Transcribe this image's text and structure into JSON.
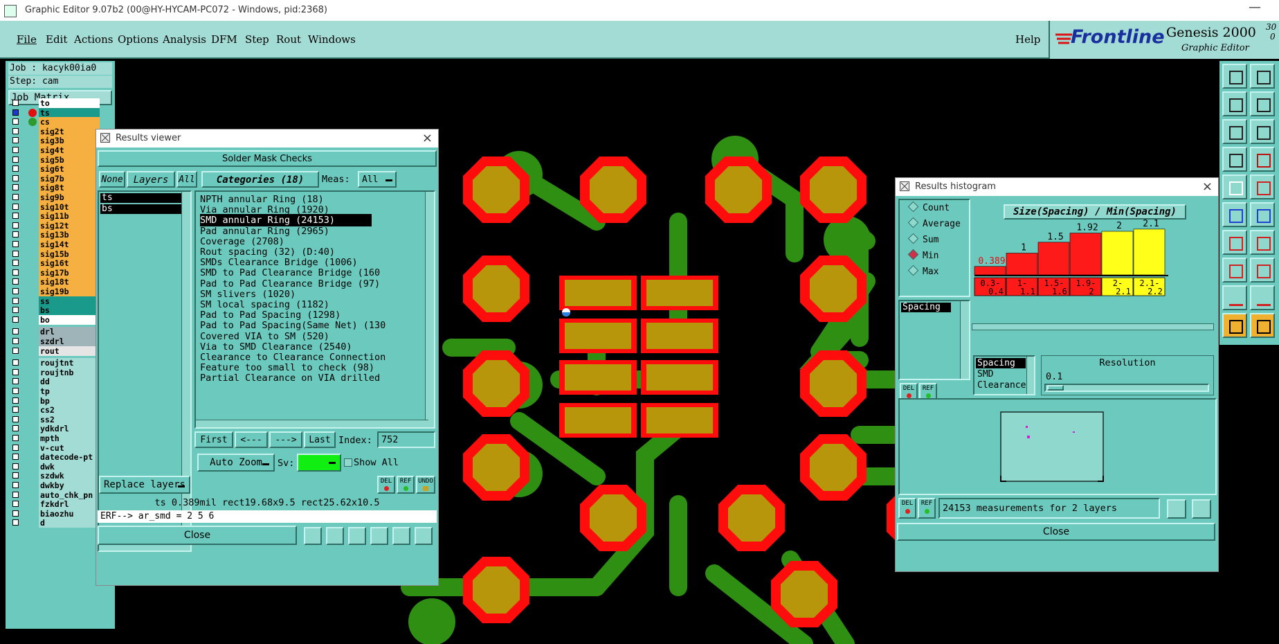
{
  "window": {
    "title": "Graphic Editor 9.07b2 (00@HY-HYCAM-PC072 - Windows, pid:2368)",
    "minimize_glyph": "—"
  },
  "menu": {
    "items": [
      "File",
      "Edit",
      "Actions",
      "Options",
      "Analysis",
      "DFM",
      "Step",
      "Rout",
      "Windows"
    ],
    "help": "Help"
  },
  "brand": {
    "logo": "Frontline",
    "product": "Genesis 2000",
    "version_top": "30",
    "version_bottom": "0",
    "subtitle": "Graphic Editor"
  },
  "job": {
    "job_label": "Job : kacyk00ia0",
    "step_label": "Step: cam",
    "matrix_button": "Job Matrix ..."
  },
  "layers": [
    {
      "name": "to",
      "bg": "#ffffff",
      "dot": ""
    },
    {
      "name": "ts",
      "bg": "#1a9a8a",
      "dot": "#e01010",
      "selected": true
    },
    {
      "name": "cs",
      "bg": "#f5b041",
      "dot": "#2c9a2c"
    },
    {
      "name": "sig2t",
      "bg": "#f5b041",
      "dot": ""
    },
    {
      "name": "sig3b",
      "bg": "#f5b041",
      "dot": ""
    },
    {
      "name": "sig4t",
      "bg": "#f5b041",
      "dot": ""
    },
    {
      "name": "sig5b",
      "bg": "#f5b041",
      "dot": ""
    },
    {
      "name": "sig6t",
      "bg": "#f5b041",
      "dot": ""
    },
    {
      "name": "sig7b",
      "bg": "#f5b041",
      "dot": ""
    },
    {
      "name": "sig8t",
      "bg": "#f5b041",
      "dot": ""
    },
    {
      "name": "sig9b",
      "bg": "#f5b041",
      "dot": ""
    },
    {
      "name": "sig10t",
      "bg": "#f5b041",
      "dot": ""
    },
    {
      "name": "sig11b",
      "bg": "#f5b041",
      "dot": ""
    },
    {
      "name": "sig12t",
      "bg": "#f5b041",
      "dot": ""
    },
    {
      "name": "sig13b",
      "bg": "#f5b041",
      "dot": ""
    },
    {
      "name": "sig14t",
      "bg": "#f5b041",
      "dot": ""
    },
    {
      "name": "sig15b",
      "bg": "#f5b041",
      "dot": ""
    },
    {
      "name": "sig16t",
      "bg": "#f5b041",
      "dot": ""
    },
    {
      "name": "sig17b",
      "bg": "#f5b041",
      "dot": ""
    },
    {
      "name": "sig18t",
      "bg": "#f5b041",
      "dot": ""
    },
    {
      "name": "sig19b",
      "bg": "#f5b041",
      "dot": ""
    },
    {
      "name": "ss",
      "bg": "#1a9a8a",
      "dot": ""
    },
    {
      "name": "bs",
      "bg": "#1a9a8a",
      "dot": ""
    },
    {
      "name": "bo",
      "bg": "#ffffff",
      "dot": ""
    },
    {
      "name": "drl",
      "bg": "#9fb4b8",
      "dot": ""
    },
    {
      "name": "szdrl",
      "bg": "#9fb4b8",
      "dot": ""
    },
    {
      "name": "rout",
      "bg": "#e5e5e5",
      "dot": ""
    },
    {
      "name": "roujtnt",
      "bg": "#a3dcd5",
      "dot": ""
    },
    {
      "name": "roujtnb",
      "bg": "#a3dcd5",
      "dot": ""
    },
    {
      "name": "dd",
      "bg": "#a3dcd5",
      "dot": ""
    },
    {
      "name": "tp",
      "bg": "#a3dcd5",
      "dot": ""
    },
    {
      "name": "bp",
      "bg": "#a3dcd5",
      "dot": ""
    },
    {
      "name": "cs2",
      "bg": "#a3dcd5",
      "dot": ""
    },
    {
      "name": "ss2",
      "bg": "#a3dcd5",
      "dot": ""
    },
    {
      "name": "ydkdrl",
      "bg": "#a3dcd5",
      "dot": ""
    },
    {
      "name": "mpth",
      "bg": "#a3dcd5",
      "dot": ""
    },
    {
      "name": "v-cut",
      "bg": "#a3dcd5",
      "dot": ""
    },
    {
      "name": "datecode-pt",
      "bg": "#a3dcd5",
      "dot": ""
    },
    {
      "name": "dwk",
      "bg": "#a3dcd5",
      "dot": ""
    },
    {
      "name": "szdwk",
      "bg": "#a3dcd5",
      "dot": ""
    },
    {
      "name": "dwkby",
      "bg": "#a3dcd5",
      "dot": ""
    },
    {
      "name": "auto_chk_pn",
      "bg": "#a3dcd5",
      "dot": ""
    },
    {
      "name": "fzkdrl",
      "bg": "#a3dcd5",
      "dot": ""
    },
    {
      "name": "biaozhu",
      "bg": "#a3dcd5",
      "dot": ""
    },
    {
      "name": "d",
      "bg": "#a3dcd5",
      "dot": ""
    }
  ],
  "results_viewer": {
    "title": "Results viewer",
    "header": "Solder Mask Checks",
    "none_btn": "None",
    "layers_btn": "Layers",
    "all_btn": "All",
    "categories_btn": "Categories (18)",
    "meas_label": "Meas:",
    "meas_value": "All",
    "layer_list": [
      "ts",
      "bs"
    ],
    "categories": [
      "NPTH annular Ring (18)",
      "Via annular Ring (1920)",
      "SMD annular Ring (24153)",
      "Pad annular Ring (2965)",
      "Coverage (2708)",
      "Rout spacing (32)          (D:40)",
      "SMDs Clearance Bridge (1006)",
      "SMD to Pad Clearance Bridge (160",
      "Pad to Pad Clearance Bridge (97)",
      "SM slivers (1020)",
      "SM local spacing (1182)",
      "Pad to Pad Spacing (1298)",
      "Pad to Pad Spacing(Same Net) (130",
      "Covered VIA to SM (520)",
      "Via to SMD Clearance (2540)",
      "Clearance to Clearance Connection",
      "Feature too small to check (98)",
      "Partial Clearance on VIA drilled"
    ],
    "selected_index": 2,
    "nav": {
      "first": "First",
      "prev": "<---",
      "next": "--->",
      "last": "Last",
      "index_label": "Index:",
      "index_value": "752"
    },
    "auto_zoom": "Auto Zoom",
    "sv_label": "Sv:",
    "show_all": "Show All",
    "replace_layers": "Replace layers",
    "del": "DEL",
    "ref": "REF",
    "undo": "UNDO",
    "status": "ts 0.389mil  rect19.68x9.5  rect25.62x10.5",
    "erf": "ERF--> ar_smd = 2 5 6",
    "close": "Close"
  },
  "histogram": {
    "title": "Results histogram",
    "modes": [
      "Count",
      "Average",
      "Sum",
      "Min",
      "Max"
    ],
    "selected_mode": "Min",
    "chart_title": "Size(Spacing) / Min(Spacing)",
    "list_item": "Spacing",
    "bars": [
      {
        "label": "0.389",
        "range": "0.3-0.4",
        "value": 0.389,
        "color": "#ff1a1a"
      },
      {
        "label": "1",
        "range": "1-1.1",
        "value": 1,
        "color": "#ff1a1a"
      },
      {
        "label": "1.5",
        "range": "1.5-1.6",
        "value": 1.5,
        "color": "#ff1a1a"
      },
      {
        "label": "1.92",
        "range": "1.9-2",
        "value": 1.92,
        "color": "#ff1a1a"
      },
      {
        "label": "2",
        "range": "2-2.1",
        "value": 2,
        "color": "#ffff1a"
      },
      {
        "label": "2.1",
        "range": "2.1-2.2",
        "value": 2.1,
        "color": "#ffff1a"
      }
    ],
    "measure_list": [
      "Spacing",
      "SMD",
      "Clearance"
    ],
    "resolution_label": "Resolution",
    "resolution_value": "0.1",
    "del": "DEL",
    "ref": "REF",
    "summary": "24153 measurements for 2 layers",
    "close": "Close"
  },
  "colors": {
    "panel": "#6cc9bd",
    "panel_light": "#a3dcd5",
    "pad_red": "#ff0d0d",
    "pad_fill": "#b8960b",
    "copper_green": "#2f8f12",
    "board_bg": "#000000"
  }
}
